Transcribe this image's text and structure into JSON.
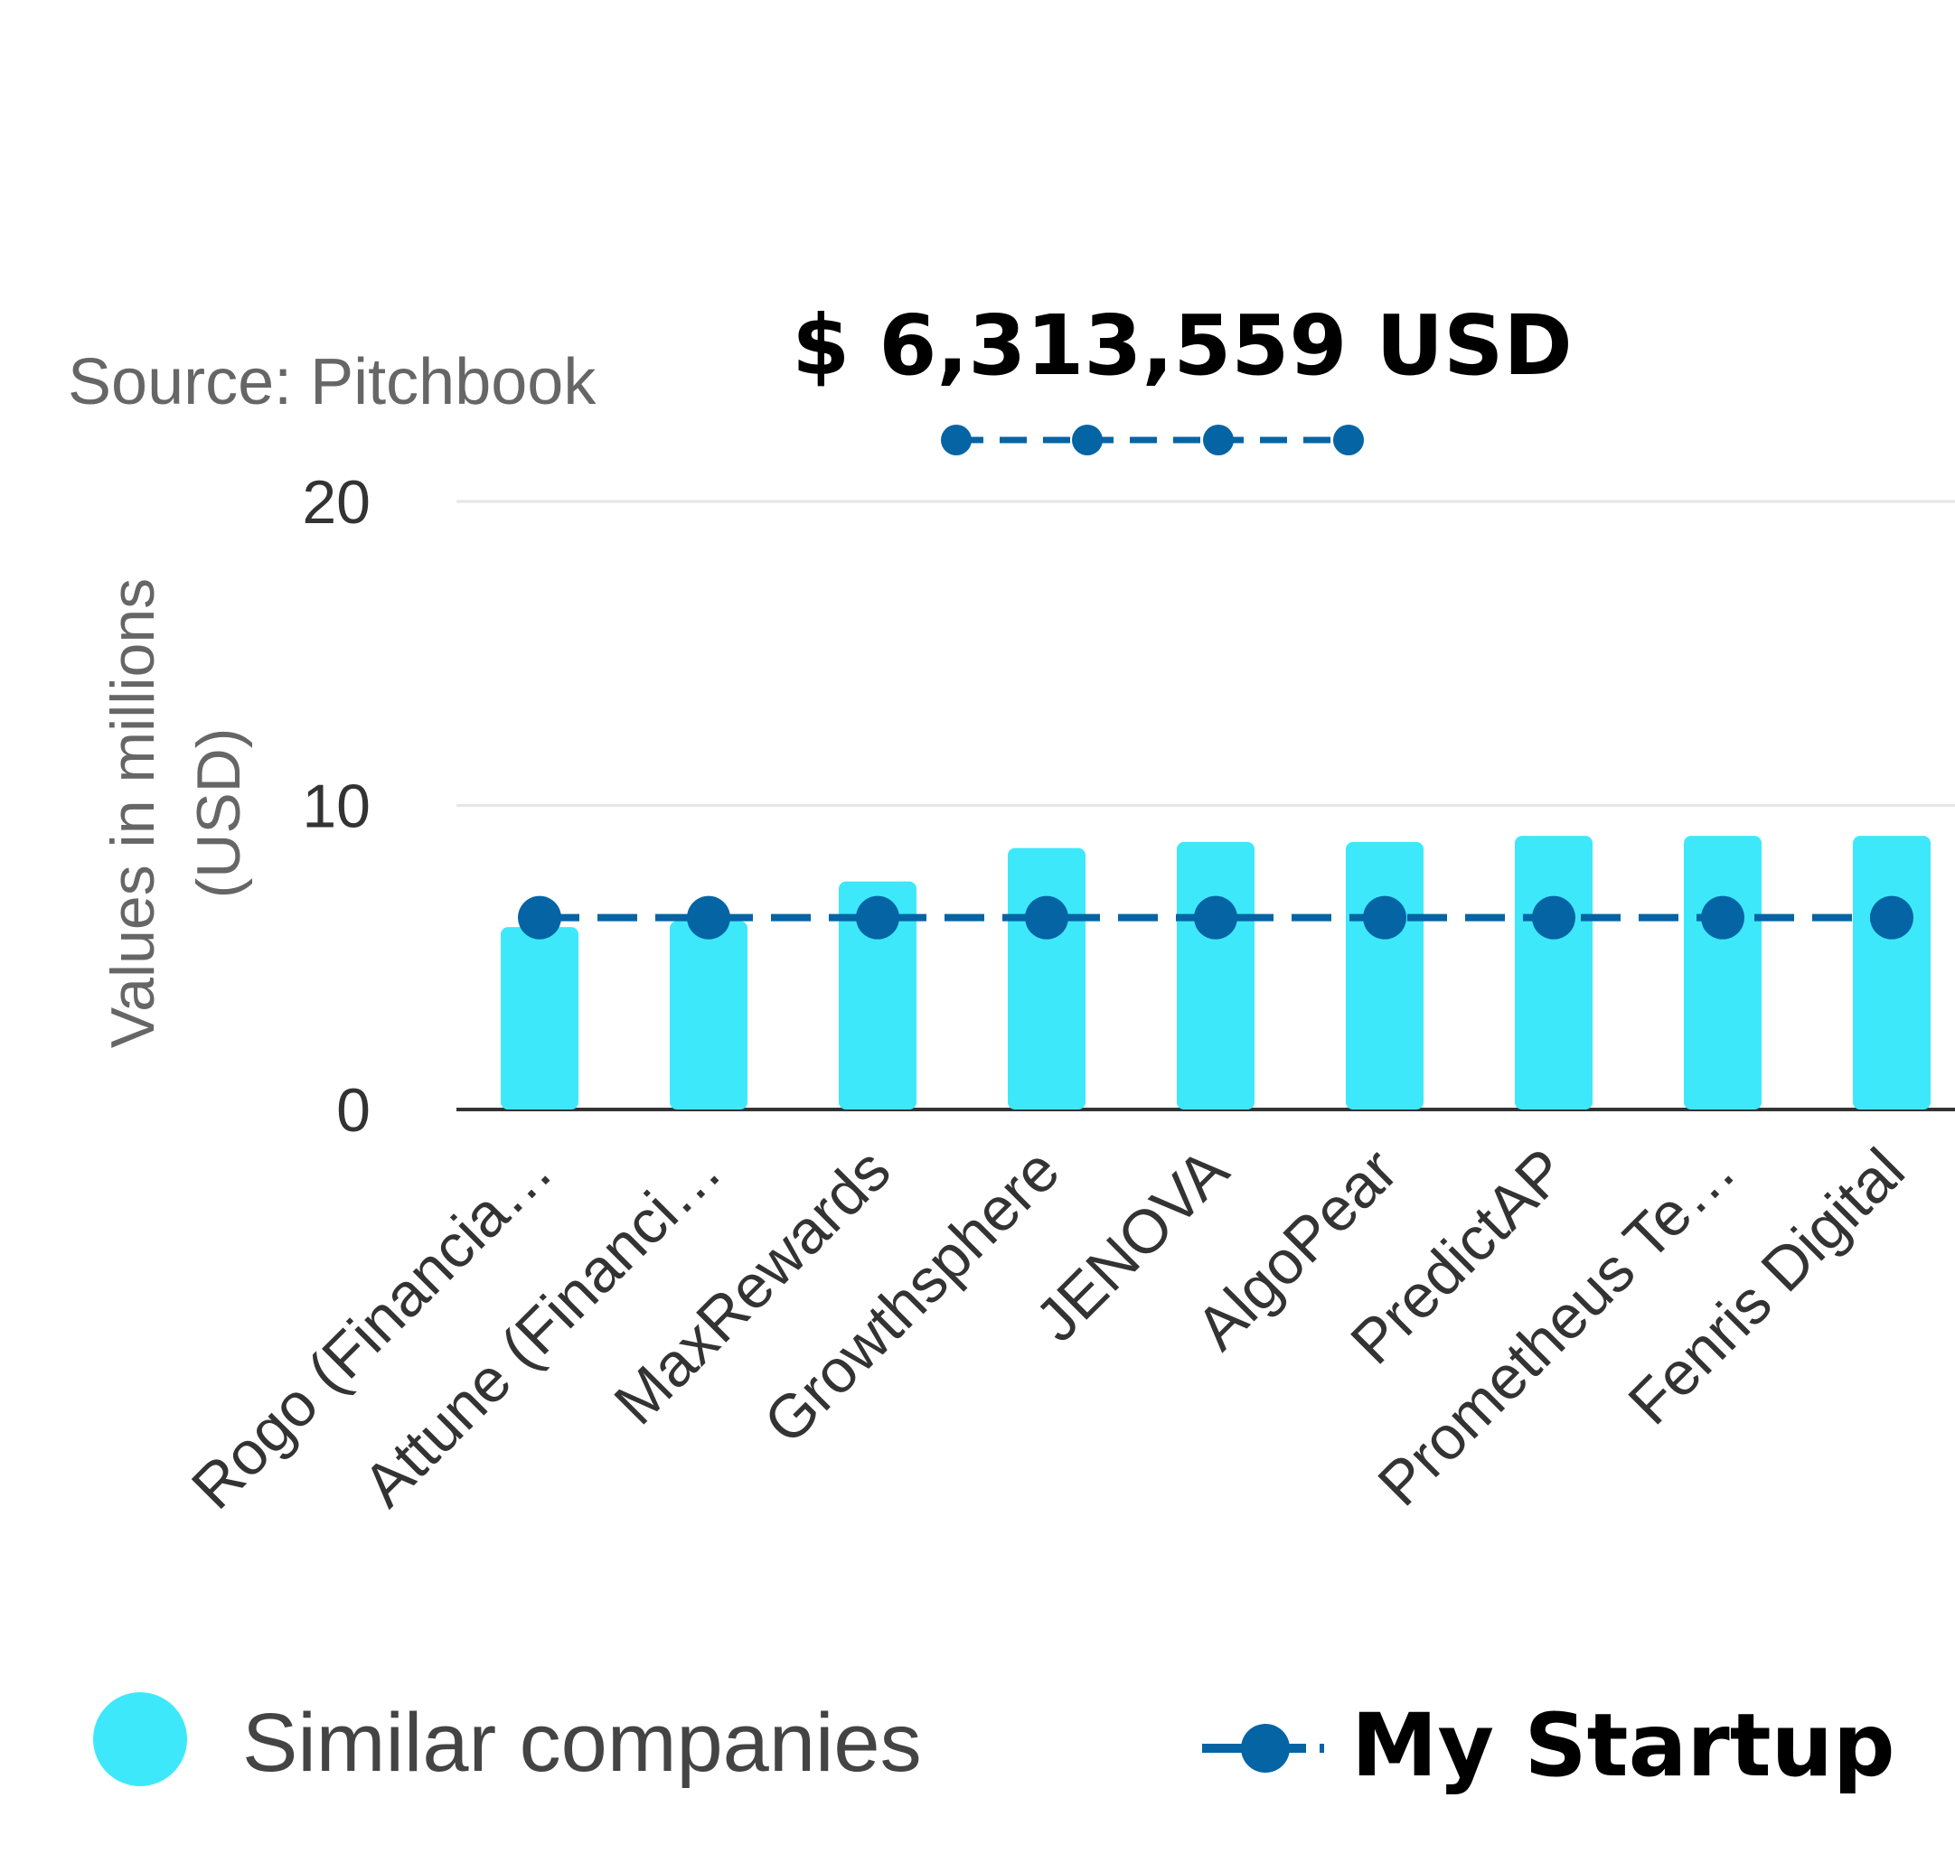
{
  "headline": "$ 6,313,559 USD",
  "source": "Source: Pitchbook",
  "colors": {
    "bars": "#3ee8fb",
    "line": "#0464a4",
    "grid": "#e6e6e6",
    "axis": "#333333"
  },
  "chart_data": {
    "type": "bar",
    "ylabel_lines": [
      "Values in millions",
      "(USD)"
    ],
    "ylim": [
      0,
      20
    ],
    "yticks": [
      0,
      10,
      20
    ],
    "grid": true,
    "legend_placement": "bottom",
    "categories": [
      "Rogo (Financia…",
      "Attune (Financi…",
      "MaxRewards",
      "Growthsphere",
      "JENOVA",
      "AlgoPear",
      "PredictAP",
      "Prometheus Te…",
      "Fenris Digital"
    ],
    "series": [
      {
        "name": "Similar companies",
        "kind": "bar",
        "values": [
          6.0,
          6.2,
          7.5,
          8.6,
          8.8,
          8.8,
          9.0,
          9.0,
          9.0
        ]
      },
      {
        "name": "My Startup",
        "kind": "line",
        "style": "dashed-markers",
        "values": [
          6.31,
          6.31,
          6.31,
          6.31,
          6.31,
          6.31,
          6.31,
          6.31,
          6.31
        ]
      }
    ]
  }
}
